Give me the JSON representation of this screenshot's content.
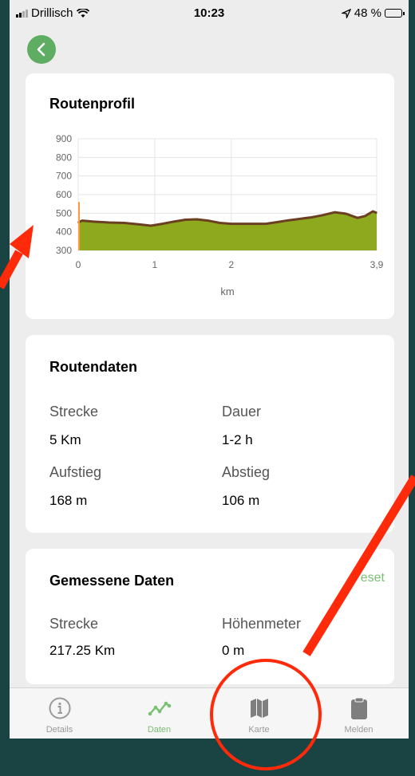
{
  "status_bar": {
    "carrier": "Drillisch",
    "time": "10:23",
    "battery_percent": "48 %",
    "battery_level": 0.48
  },
  "profile_card": {
    "title": "Routenprofil",
    "xlabel": "km"
  },
  "chart_data": {
    "type": "area",
    "title": "Routenprofil",
    "xlabel": "km",
    "ylabel": "",
    "x_ticks": [
      "0",
      "1",
      "2",
      "3,9"
    ],
    "y_ticks": [
      "900",
      "800",
      "700",
      "600",
      "500",
      "400",
      "300"
    ],
    "xlim": [
      0,
      3.9
    ],
    "ylim": [
      300,
      900
    ],
    "grid": true,
    "colors": {
      "fill": "#8fa91f",
      "line": "#6b3f22",
      "spike": "#ff9a3c"
    },
    "series": [
      {
        "x": [
          0,
          0.05,
          0.2,
          0.4,
          0.6,
          0.8,
          0.95,
          1.1,
          1.25,
          1.4,
          1.55,
          1.7,
          1.85,
          2.0,
          2.15,
          2.3,
          2.45,
          2.6,
          2.75,
          2.9,
          3.05,
          3.2,
          3.35,
          3.5,
          3.65,
          3.75,
          3.85,
          3.9
        ],
        "y": [
          450,
          460,
          455,
          450,
          448,
          440,
          433,
          443,
          455,
          465,
          467,
          460,
          448,
          443,
          443,
          443,
          443,
          452,
          462,
          470,
          478,
          490,
          505,
          497,
          475,
          485,
          510,
          502
        ]
      }
    ]
  },
  "route_data": {
    "title": "Routendaten",
    "distance_label": "Strecke",
    "distance_value": "5 Km",
    "duration_label": "Dauer",
    "duration_value": "1-2 h",
    "ascent_label": "Aufstieg",
    "ascent_value": "168 m",
    "descent_label": "Abstieg",
    "descent_value": "106 m"
  },
  "measured_data": {
    "title": "Gemessene Daten",
    "reset_label": "eset",
    "distance_label": "Strecke",
    "distance_value": "217.25 Km",
    "elevation_label": "Höhenmeter",
    "elevation_value": "0 m"
  },
  "tabs": [
    {
      "label": "Details",
      "icon": "info-icon"
    },
    {
      "label": "Daten",
      "icon": "chart-line-icon",
      "active": true
    },
    {
      "label": "Karte",
      "icon": "map-icon"
    },
    {
      "label": "Melden",
      "icon": "clipboard-icon"
    }
  ],
  "colors": {
    "accent": "#7bbf72",
    "back_button": "#5fad62",
    "annotation": "#ff2a0a",
    "background": "#1a4444"
  }
}
